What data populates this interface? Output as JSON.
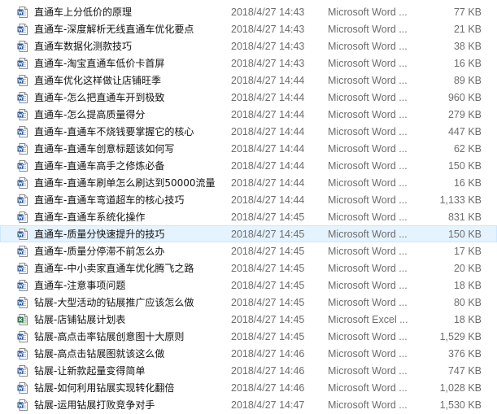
{
  "files": [
    {
      "name": "直通车上分低价的原理",
      "modified": "2018/4/27 14:43",
      "type": "Microsoft Word ...",
      "size": "77 KB",
      "icon": "word-doc-icon"
    },
    {
      "name": "直通车-深度解析无线直通车优化要点",
      "modified": "2018/4/27 14:43",
      "type": "Microsoft Word ...",
      "size": "21 KB",
      "icon": "word-doc-icon"
    },
    {
      "name": "直通车数据化测款技巧",
      "modified": "2018/4/27 14:43",
      "type": "Microsoft Word ...",
      "size": "38 KB",
      "icon": "word-doc-icon"
    },
    {
      "name": "直通车-淘宝直通车低价卡首屏",
      "modified": "2018/4/27 14:43",
      "type": "Microsoft Word ...",
      "size": "16 KB",
      "icon": "word-doc-icon"
    },
    {
      "name": "直通车优化这样做让店铺旺季",
      "modified": "2018/4/27 14:44",
      "type": "Microsoft Word ...",
      "size": "89 KB",
      "icon": "word-doc-icon"
    },
    {
      "name": "直通车-怎么把直通车开到极致",
      "modified": "2018/4/27 14:44",
      "type": "Microsoft Word ...",
      "size": "960 KB",
      "icon": "word-doc-icon"
    },
    {
      "name": "直通车-怎么提高质量得分",
      "modified": "2018/4/27 14:44",
      "type": "Microsoft Word ...",
      "size": "279 KB",
      "icon": "word-doc-icon"
    },
    {
      "name": "直通车-直通车不烧钱要掌握它的核心",
      "modified": "2018/4/27 14:44",
      "type": "Microsoft Word ...",
      "size": "447 KB",
      "icon": "word-doc-icon"
    },
    {
      "name": "直通车-直通车创意标题该如何写",
      "modified": "2018/4/27 14:44",
      "type": "Microsoft Word ...",
      "size": "62 KB",
      "icon": "word-doc-icon"
    },
    {
      "name": "直通车-直通车高手之修炼必备",
      "modified": "2018/4/27 14:44",
      "type": "Microsoft Word ...",
      "size": "150 KB",
      "icon": "word-doc-icon"
    },
    {
      "name": "直通车-直通车刷单怎么刷达到50000流量",
      "modified": "2018/4/27 14:44",
      "type": "Microsoft Word ...",
      "size": "16 KB",
      "icon": "word-doc-icon"
    },
    {
      "name": "直通车-直通车弯道超车的核心技巧",
      "modified": "2018/4/27 14:44",
      "type": "Microsoft Word ...",
      "size": "1,133 KB",
      "icon": "word-doc-icon"
    },
    {
      "name": "直通车-直通车系统化操作",
      "modified": "2018/4/27 14:45",
      "type": "Microsoft Word ...",
      "size": "831 KB",
      "icon": "word-doc-icon"
    },
    {
      "name": "直通车-质量分快速提升的技巧",
      "modified": "2018/4/27 14:45",
      "type": "Microsoft Word ...",
      "size": "150 KB",
      "icon": "word-doc-icon",
      "selected": true
    },
    {
      "name": "直通车-质量分停滞不前怎么办",
      "modified": "2018/4/27 14:45",
      "type": "Microsoft Word ...",
      "size": "17 KB",
      "icon": "word-doc-icon"
    },
    {
      "name": "直通车-中小卖家直通车优化腾飞之路",
      "modified": "2018/4/27 14:45",
      "type": "Microsoft Word ...",
      "size": "20 KB",
      "icon": "word-doc-icon"
    },
    {
      "name": "直通车-注意事项问题",
      "modified": "2018/4/27 14:45",
      "type": "Microsoft Word ...",
      "size": "18 KB",
      "icon": "word-doc-icon"
    },
    {
      "name": "钻展-大型活动的钻展推广应该怎么做",
      "modified": "2018/4/27 14:45",
      "type": "Microsoft Word ...",
      "size": "80 KB",
      "icon": "word-doc-icon"
    },
    {
      "name": "钻展-店铺钻展计划表",
      "modified": "2018/4/27 14:45",
      "type": "Microsoft Excel ...",
      "size": "18 KB",
      "icon": "excel-sheet-icon"
    },
    {
      "name": "钻展-高点击率钻展创意图十大原则",
      "modified": "2018/4/27 14:45",
      "type": "Microsoft Word ...",
      "size": "1,529 KB",
      "icon": "word-doc-icon"
    },
    {
      "name": "钻展-高点击钻展图就该这么做",
      "modified": "2018/4/27 14:46",
      "type": "Microsoft Word ...",
      "size": "376 KB",
      "icon": "word-doc-icon"
    },
    {
      "name": "钻展-让新款起量变得简单",
      "modified": "2018/4/27 14:46",
      "type": "Microsoft Word ...",
      "size": "747 KB",
      "icon": "word-doc-icon"
    },
    {
      "name": "钻展-如何利用钻展实现转化翻倍",
      "modified": "2018/4/27 14:46",
      "type": "Microsoft Word ...",
      "size": "1,028 KB",
      "icon": "word-doc-icon"
    },
    {
      "name": "钻展-运用钻展打败竞争对手",
      "modified": "2018/4/27 14:47",
      "type": "Microsoft Word ...",
      "size": "1,530 KB",
      "icon": "word-doc-icon"
    }
  ],
  "colors": {
    "selected_bg": "#e5f3ff",
    "selected_border": "#cce8ff",
    "word_blue": "#2b579a",
    "excel_green": "#217346",
    "meta_text": "#6d6d6d"
  }
}
